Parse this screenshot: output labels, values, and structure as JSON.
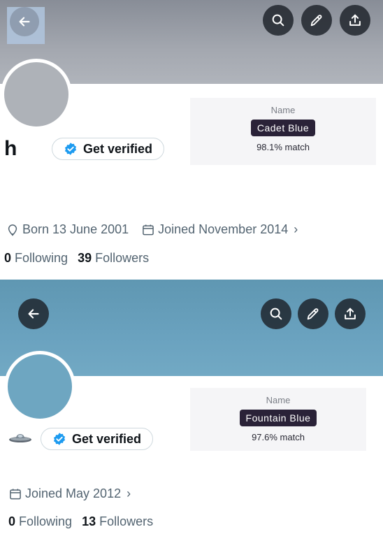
{
  "panels": [
    {
      "handle": "h",
      "verify_label": "Get verified",
      "name_card": {
        "label": "Name",
        "color_name": "Cadet Blue",
        "match": "98.1% match"
      },
      "born": "Born 13 June 2001",
      "joined": "Joined November 2014",
      "following_count": "0",
      "following_label": "Following",
      "followers_count": "39",
      "followers_label": "Followers"
    },
    {
      "verify_label": "Get verified",
      "name_card": {
        "label": "Name",
        "color_name": "Fountain Blue",
        "match": "97.6% match"
      },
      "joined": "Joined May 2012",
      "following_count": "0",
      "following_label": "Following",
      "followers_count": "13",
      "followers_label": "Followers"
    }
  ],
  "icons": [
    "back-arrow-icon",
    "search-icon",
    "edit-pencil-icon",
    "share-upload-icon",
    "verified-badge-icon",
    "location-pin-icon",
    "calendar-icon",
    "chevron-right-icon",
    "ufo-icon"
  ],
  "colors": {
    "banner_1": "#9ea2aa",
    "banner_2": "#6aa2bf",
    "verified_blue": "#1d9bf0",
    "chip_bg": "#2a2238"
  }
}
